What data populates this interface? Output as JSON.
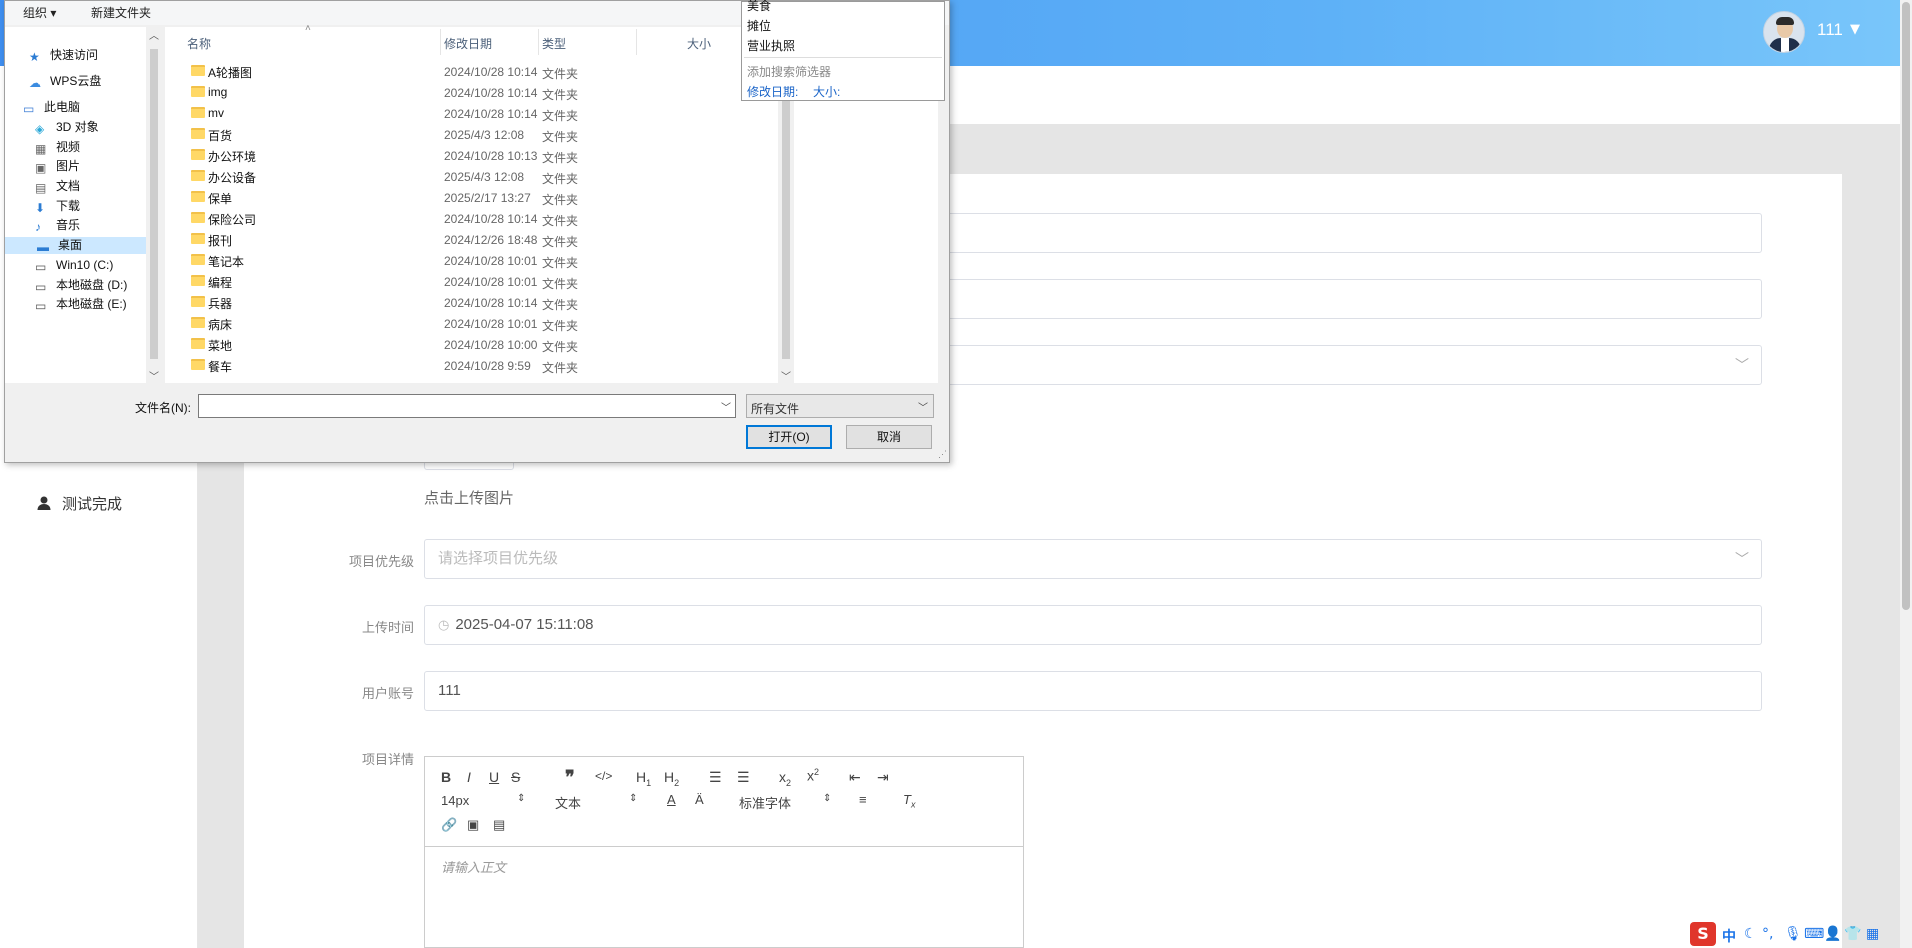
{
  "app": {
    "user": {
      "name": "111"
    },
    "sidebar": {
      "items": [
        {
          "label": "测试完成"
        }
      ]
    },
    "form": {
      "upload_hint": "点击上传图片",
      "priority": {
        "label": "项目优先级",
        "placeholder": "请选择项目优先级"
      },
      "upload_time": {
        "label": "上传时间",
        "value": "2025-04-07 15:11:08"
      },
      "account": {
        "label": "用户账号",
        "value": "111"
      },
      "detail": {
        "label": "项目详情"
      }
    },
    "editor": {
      "font_size": "14px",
      "text_style": "文本",
      "font_family": "标准字体",
      "placeholder": "请输入正文"
    }
  },
  "dialog": {
    "toolbar": {
      "organize": "组织 ▾",
      "new_folder": "新建文件夹"
    },
    "nav": [
      {
        "label": "快速访问",
        "icon": "star-icon"
      },
      {
        "label": "WPS云盘",
        "icon": "cloud-icon"
      },
      {
        "label": "此电脑",
        "icon": "pc-icon"
      },
      {
        "label": "3D 对象",
        "icon": "cube-icon"
      },
      {
        "label": "视频",
        "icon": "video-icon"
      },
      {
        "label": "图片",
        "icon": "picture-icon"
      },
      {
        "label": "文档",
        "icon": "document-icon"
      },
      {
        "label": "下载",
        "icon": "download-icon"
      },
      {
        "label": "音乐",
        "icon": "music-icon"
      },
      {
        "label": "桌面",
        "icon": "desktop-icon",
        "selected": true
      },
      {
        "label": "Win10 (C:)",
        "icon": "drive-icon"
      },
      {
        "label": "本地磁盘 (D:)",
        "icon": "drive-icon"
      },
      {
        "label": "本地磁盘 (E:)",
        "icon": "drive-icon"
      }
    ],
    "columns": {
      "name": "名称",
      "date": "修改日期",
      "type": "类型",
      "size": "大小"
    },
    "files": [
      {
        "name": "A轮播图",
        "date": "2024/10/28 10:14",
        "type": "文件夹"
      },
      {
        "name": "img",
        "date": "2024/10/28 10:14",
        "type": "文件夹"
      },
      {
        "name": "mv",
        "date": "2024/10/28 10:14",
        "type": "文件夹"
      },
      {
        "name": "百货",
        "date": "2025/4/3 12:08",
        "type": "文件夹"
      },
      {
        "name": "办公环境",
        "date": "2024/10/28 10:13",
        "type": "文件夹"
      },
      {
        "name": "办公设备",
        "date": "2025/4/3 12:08",
        "type": "文件夹"
      },
      {
        "name": "保单",
        "date": "2025/2/17 13:27",
        "type": "文件夹"
      },
      {
        "name": "保险公司",
        "date": "2024/10/28 10:14",
        "type": "文件夹"
      },
      {
        "name": "报刊",
        "date": "2024/12/26 18:48",
        "type": "文件夹"
      },
      {
        "name": "笔记本",
        "date": "2024/10/28 10:01",
        "type": "文件夹"
      },
      {
        "name": "编程",
        "date": "2024/10/28 10:01",
        "type": "文件夹"
      },
      {
        "name": "兵器",
        "date": "2024/10/28 10:14",
        "type": "文件夹"
      },
      {
        "name": "病床",
        "date": "2024/10/28 10:01",
        "type": "文件夹"
      },
      {
        "name": "菜地",
        "date": "2024/10/28 10:00",
        "type": "文件夹"
      },
      {
        "name": "餐车",
        "date": "2024/10/28 9:59",
        "type": "文件夹"
      }
    ],
    "search_popup": {
      "options": [
        "美食",
        "摊位",
        "营业执照"
      ],
      "add_filter": "添加搜索筛选器",
      "filters": [
        "修改日期:",
        "大小:"
      ]
    },
    "filename_label": "文件名(N):",
    "filename_value": "",
    "filetype": "所有文件",
    "open_button": "打开(O)",
    "cancel_button": "取消"
  },
  "tray": {
    "ime": "中"
  }
}
